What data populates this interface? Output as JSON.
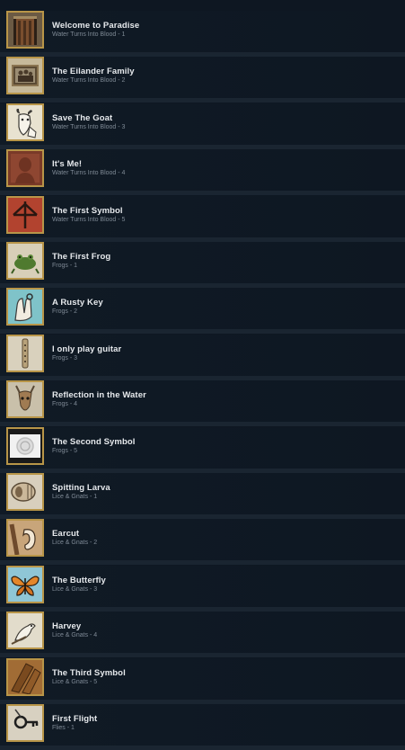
{
  "achievements": [
    {
      "title": "Welcome to Paradise",
      "subtitle": "Water Turns Into Blood - 1",
      "icon": "doorway-icon"
    },
    {
      "title": "The Eilander Family",
      "subtitle": "Water Turns Into Blood - 2",
      "icon": "family-portrait-icon"
    },
    {
      "title": "Save The Goat",
      "subtitle": "Water Turns Into Blood - 3",
      "icon": "goat-icon"
    },
    {
      "title": "It's Me!",
      "subtitle": "Water Turns Into Blood - 4",
      "icon": "portrait-icon"
    },
    {
      "title": "The First Symbol",
      "subtitle": "Water Turns Into Blood - 5",
      "icon": "arrow-symbol-icon"
    },
    {
      "title": "The First Frog",
      "subtitle": "Frogs - 1",
      "icon": "frog-icon"
    },
    {
      "title": "A Rusty Key",
      "subtitle": "Frogs - 2",
      "icon": "hand-key-icon"
    },
    {
      "title": "I only play guitar",
      "subtitle": "Frogs - 3",
      "icon": "flute-icon"
    },
    {
      "title": "Reflection in the Water",
      "subtitle": "Frogs - 4",
      "icon": "deer-skull-icon"
    },
    {
      "title": "The Second Symbol",
      "subtitle": "Frogs - 5",
      "icon": "coin-symbol-icon"
    },
    {
      "title": "Spitting Larva",
      "subtitle": "Lice & Gnats - 1",
      "icon": "larva-icon"
    },
    {
      "title": "Earcut",
      "subtitle": "Lice & Gnats - 2",
      "icon": "ear-icon"
    },
    {
      "title": "The Butterfly",
      "subtitle": "Lice & Gnats - 3",
      "icon": "butterfly-icon"
    },
    {
      "title": "Harvey",
      "subtitle": "Lice & Gnats - 4",
      "icon": "parrot-icon"
    },
    {
      "title": "The Third Symbol",
      "subtitle": "Lice & Gnats - 5",
      "icon": "wood-planks-icon"
    },
    {
      "title": "First Flight",
      "subtitle": "Flies - 1",
      "icon": "key-icon"
    }
  ]
}
